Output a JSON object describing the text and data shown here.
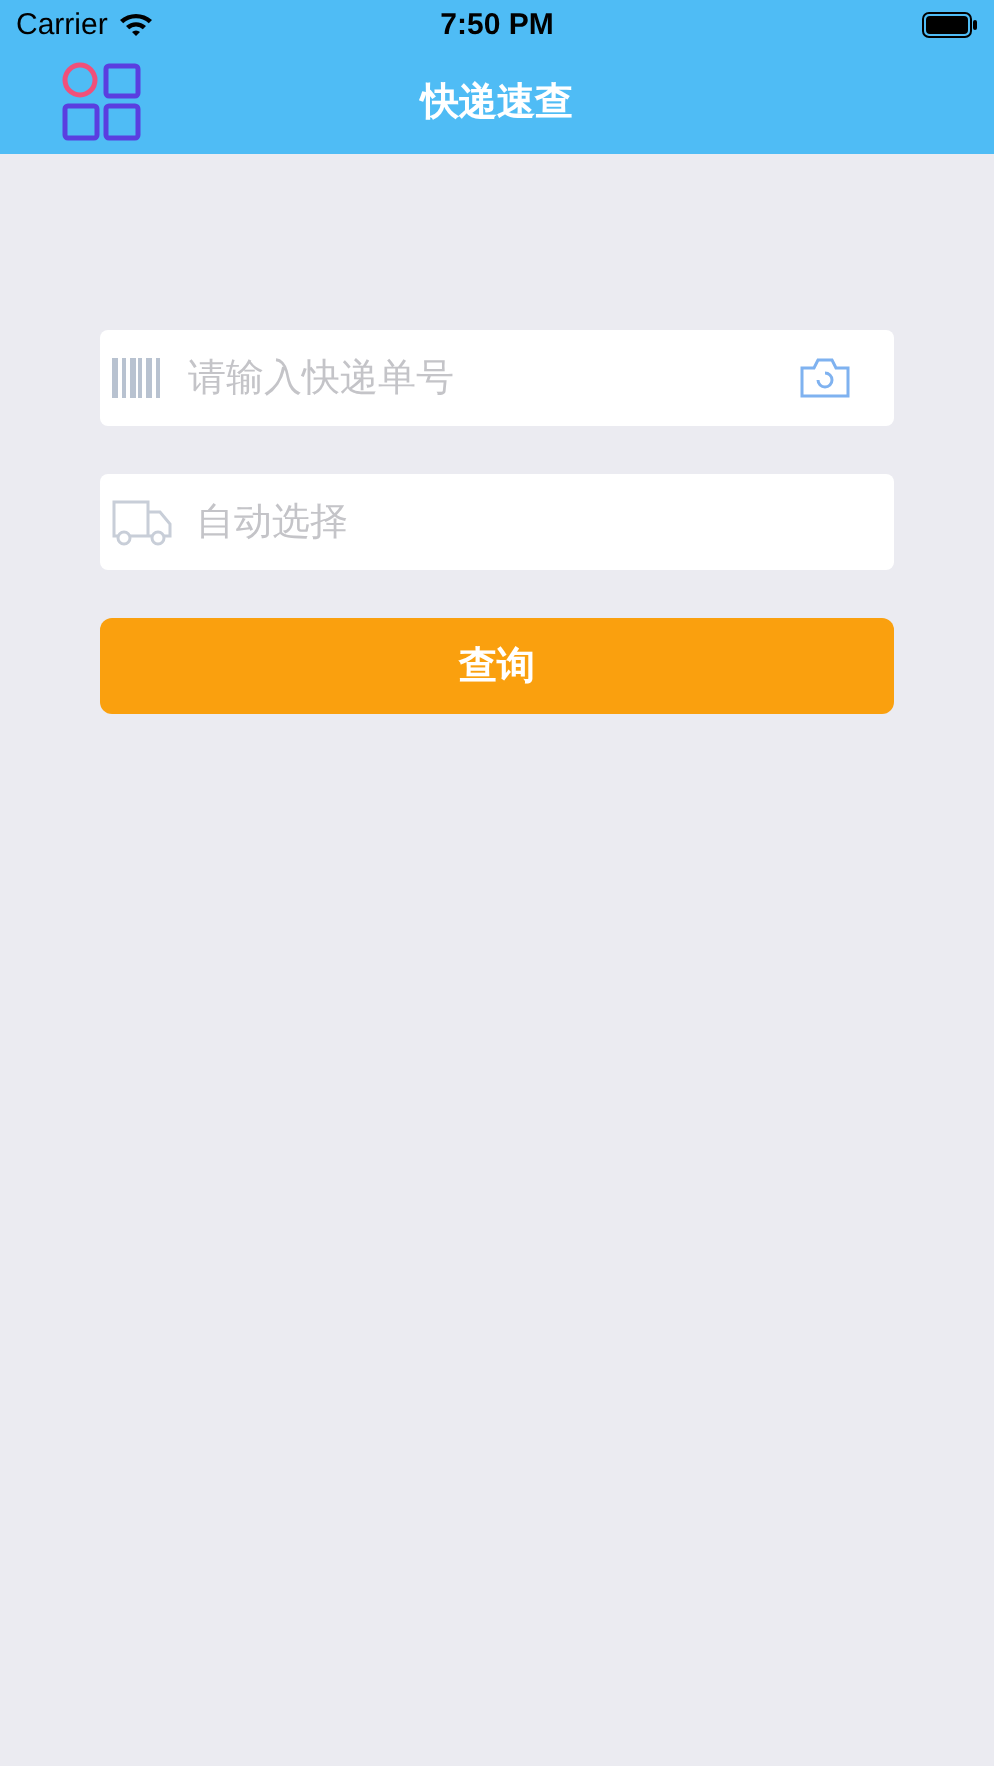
{
  "status_bar": {
    "carrier": "Carrier",
    "time": "7:50 PM"
  },
  "nav_bar": {
    "title": "快递速查"
  },
  "tracking_field": {
    "placeholder": "请输入快递单号"
  },
  "courier_field": {
    "placeholder": "自动选择"
  },
  "query_button": {
    "label": "查询"
  }
}
